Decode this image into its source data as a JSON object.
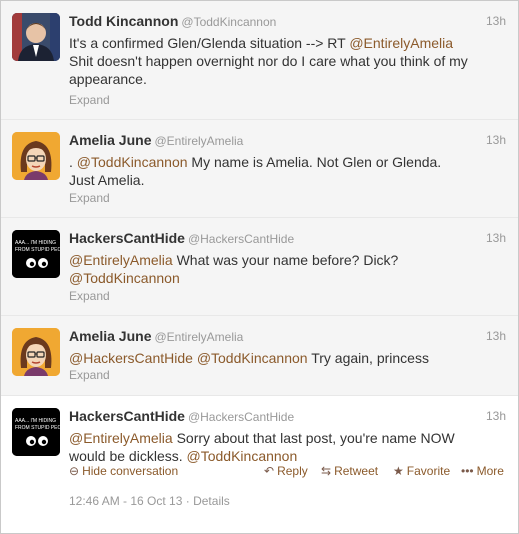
{
  "tweets": [
    {
      "name": "Todd Kincannon",
      "handle": "@ToddKincannon",
      "time": "13h",
      "text_parts": [
        {
          "t": "It's a confirmed Glen/Glenda situation --> RT ",
          "m": false
        },
        {
          "t": "@EntirelyAmelia",
          "m": true
        },
        {
          "t": " Shit doesn't happen overnight nor do I care what you think of my appearance.",
          "m": false
        }
      ],
      "expand": "Expand"
    },
    {
      "name": "Amelia June",
      "handle": "@EntirelyAmelia",
      "time": "13h",
      "text_parts": [
        {
          "t": ". ",
          "m": false
        },
        {
          "t": "@ToddKincannon",
          "m": true
        },
        {
          "t": " My name is Amelia. Not Glen or Glenda. Just Amelia.",
          "m": false
        }
      ],
      "expand": "Expand"
    },
    {
      "name": "HackersCantHide",
      "handle": "@HackersCantHide",
      "time": "13h",
      "text_parts": [
        {
          "t": "@EntirelyAmelia",
          "m": true
        },
        {
          "t": " What was your name before? Dick? ",
          "m": false
        },
        {
          "t": "@ToddKincannon",
          "m": true
        }
      ],
      "expand": "Expand"
    },
    {
      "name": "Amelia June",
      "handle": "@EntirelyAmelia",
      "time": "13h",
      "text_parts": [
        {
          "t": "@HackersCantHide",
          "m": true
        },
        {
          "t": " ",
          "m": false
        },
        {
          "t": "@ToddKincannon",
          "m": true
        },
        {
          "t": " Try again, princess",
          "m": false
        }
      ],
      "expand": "Expand"
    },
    {
      "name": "HackersCantHide",
      "handle": "@HackersCantHide",
      "time": "13h",
      "text_parts": [
        {
          "t": "@EntirelyAmelia",
          "m": true
        },
        {
          "t": " Sorry about that last post, you're name NOW would be dickless. ",
          "m": false
        },
        {
          "t": "@ToddKincannon",
          "m": true
        }
      ],
      "actions": {
        "hide": "Hide conversation",
        "reply": "Reply",
        "retweet": "Retweet",
        "favorite": "Favorite",
        "more": "More"
      },
      "details_time": "12:46 AM - 16 Oct 13",
      "details_sep": "·",
      "details_link": "Details"
    }
  ],
  "avatar_text": {
    "hackers": "AAA... I'M HIDING FROM STUPID PEOPLE"
  },
  "colors": {
    "mention": "#8b5a2b",
    "amelia_avatar_bg": "#f0a832",
    "hackers_avatar_bg": "#000000"
  },
  "icons": {
    "hide": "minus-circle-icon",
    "reply": "reply-arrow-icon",
    "retweet": "retweet-icon",
    "favorite": "star-icon",
    "more": "dots-icon"
  }
}
